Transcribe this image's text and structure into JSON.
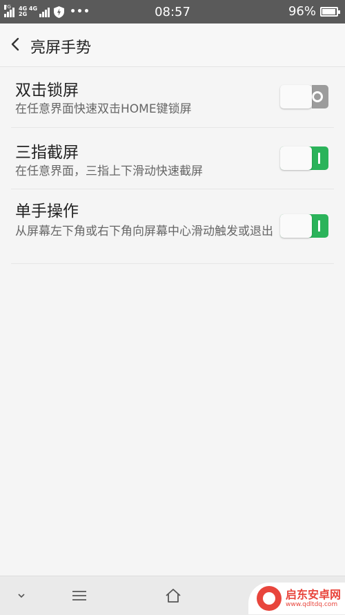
{
  "status_bar": {
    "sim1": "2G",
    "net_top": "4G 4G",
    "net_bottom": "2G",
    "time": "08:57",
    "battery_pct": "96%",
    "battery_level": 0.96,
    "icons": [
      "signal-icon",
      "signal-icon",
      "shield-icon",
      "more-icon",
      "battery-icon"
    ]
  },
  "header": {
    "title": "亮屏手势",
    "back_icon": "chevron-left-icon"
  },
  "settings": [
    {
      "title": "双击锁屏",
      "subtitle": "在任意界面快速双击HOME键锁屏",
      "enabled": false
    },
    {
      "title": "三指截屏",
      "subtitle": "在任意界面，三指上下滑动快速截屏",
      "enabled": true
    },
    {
      "title": "单手操作",
      "subtitle": "从屏幕左下角或右下角向屏幕中心滑动触发或退出",
      "enabled": true
    }
  ],
  "colors": {
    "accent_on": "#2bb35a",
    "status_bar": "#5a5a5a",
    "background": "#f5f5f5"
  },
  "nav_bar": {
    "icons": [
      "chevron-down-icon",
      "menu-icon",
      "home-icon"
    ]
  },
  "watermark": {
    "name": "启东安卓网",
    "url": "www.qdltdq.com"
  }
}
